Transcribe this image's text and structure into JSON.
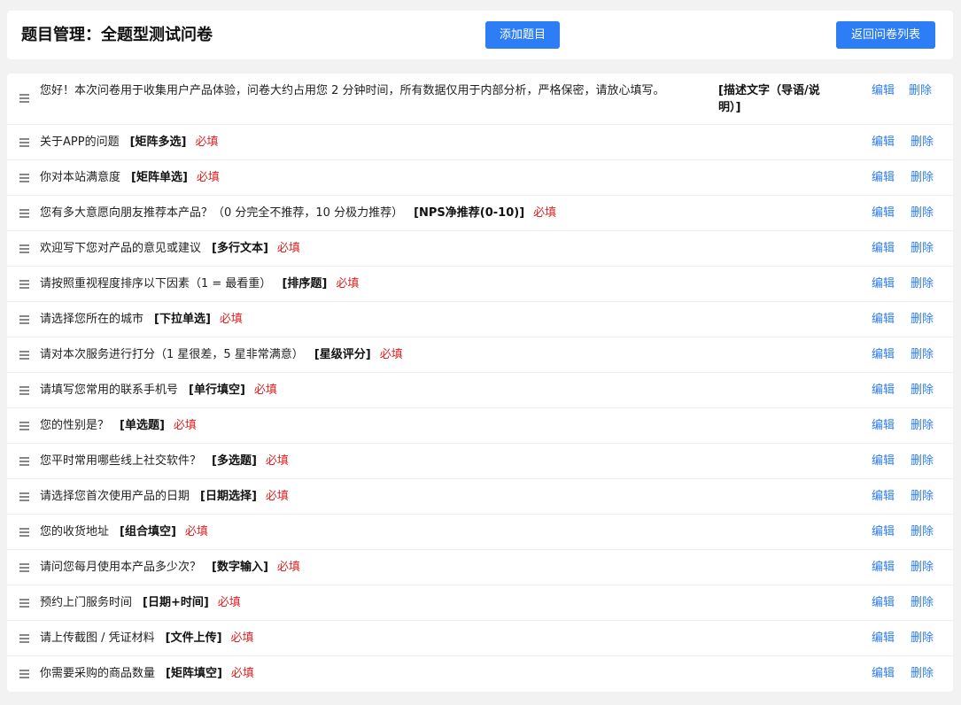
{
  "header": {
    "title": "题目管理：全题型测试问卷",
    "add_label": "添加题目",
    "back_label": "返回问卷列表"
  },
  "actions": {
    "edit": "编辑",
    "delete": "删除"
  },
  "questions": [
    {
      "text": "您好！本次问卷用于收集用户产品体验，问卷大约占用您 2 分钟时间，所有数据仅用于内部分析，严格保密，请放心填写。",
      "type": "[描述文字（导语/说明）]",
      "required": ""
    },
    {
      "text": "关于APP的问题",
      "type": "[矩阵多选]",
      "required": "必填"
    },
    {
      "text": "你对本站满意度",
      "type": "[矩阵单选]",
      "required": "必填"
    },
    {
      "text": "您有多大意愿向朋友推荐本产品？（0 分完全不推荐，10 分极力推荐）",
      "type": "[NPS净推荐(0-10)]",
      "required": "必填"
    },
    {
      "text": "欢迎写下您对产品的意见或建议",
      "type": "[多行文本]",
      "required": "必填"
    },
    {
      "text": "请按照重视程度排序以下因素（1 = 最看重）",
      "type": "[排序题]",
      "required": "必填"
    },
    {
      "text": "请选择您所在的城市",
      "type": "[下拉单选]",
      "required": "必填"
    },
    {
      "text": "请对本次服务进行打分（1 星很差，5 星非常满意）",
      "type": "[星级评分]",
      "required": "必填"
    },
    {
      "text": "请填写您常用的联系手机号",
      "type": "[单行填空]",
      "required": "必填"
    },
    {
      "text": "您的性别是？",
      "type": "[单选题]",
      "required": "必填"
    },
    {
      "text": "您平时常用哪些线上社交软件？",
      "type": "[多选题]",
      "required": "必填"
    },
    {
      "text": "请选择您首次使用产品的日期",
      "type": "[日期选择]",
      "required": "必填"
    },
    {
      "text": "您的收货地址",
      "type": "[组合填空]",
      "required": "必填"
    },
    {
      "text": "请问您每月使用本产品多少次？",
      "type": "[数字输入]",
      "required": "必填"
    },
    {
      "text": "预约上门服务时间",
      "type": "[日期+时间]",
      "required": "必填"
    },
    {
      "text": "请上传截图 / 凭证材料",
      "type": "[文件上传]",
      "required": "必填"
    },
    {
      "text": "你需要采购的商品数量",
      "type": "[矩阵填空]",
      "required": "必填"
    }
  ]
}
